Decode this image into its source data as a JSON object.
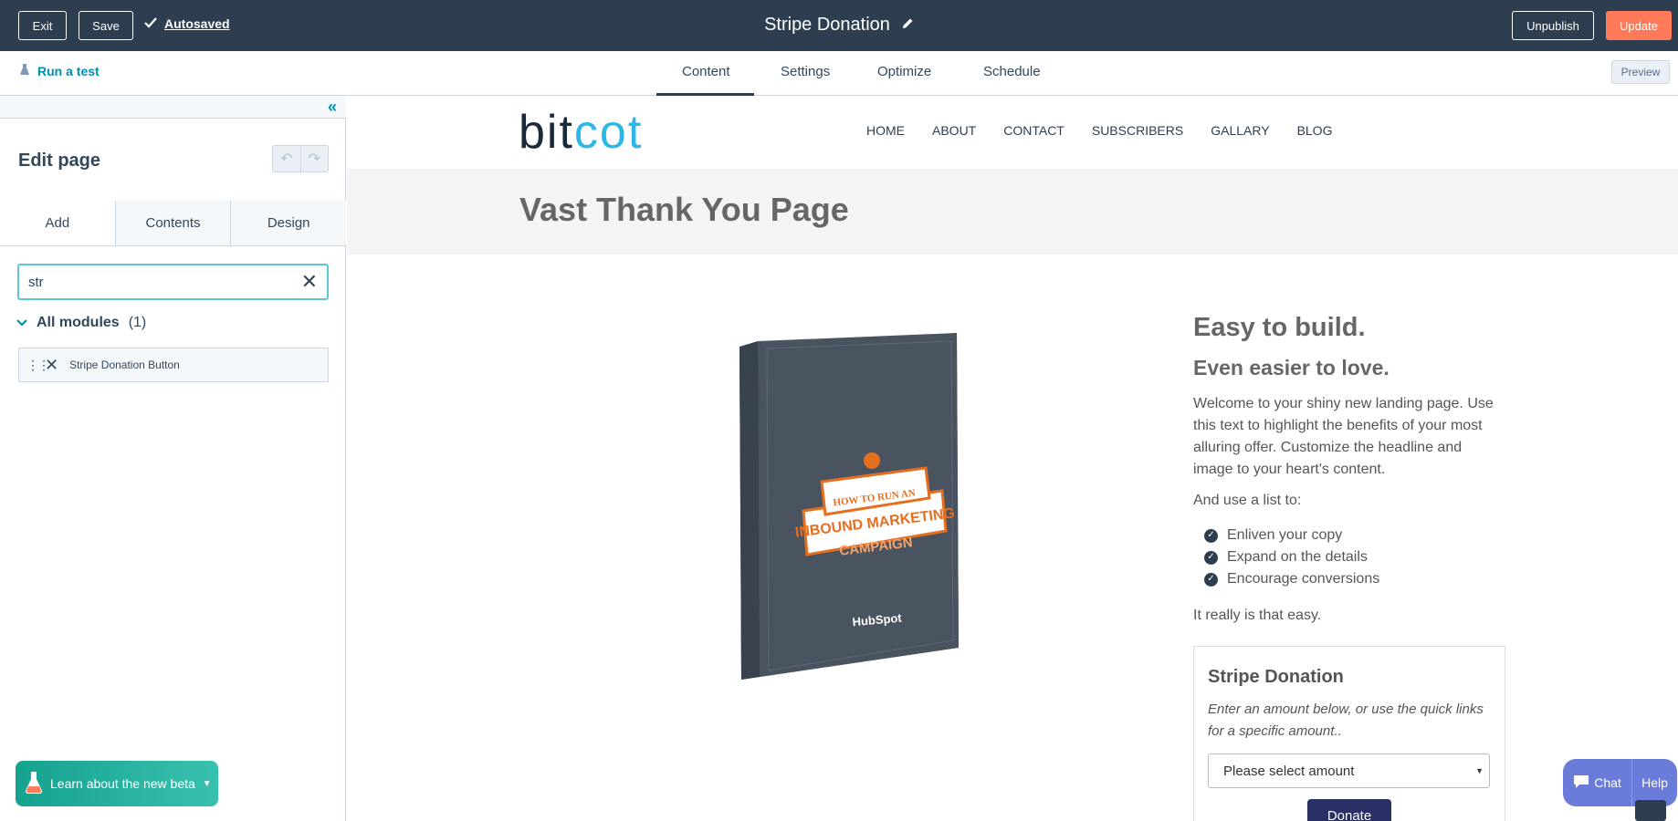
{
  "topbar": {
    "exit_label": "Exit",
    "save_label": "Save",
    "autosaved_label": "Autosaved",
    "page_title": "Stripe Donation",
    "unpublish_label": "Unpublish",
    "update_label": "Update"
  },
  "subbar": {
    "run_test_label": "Run a test",
    "tabs": [
      "Content",
      "Settings",
      "Optimize",
      "Schedule"
    ],
    "active_tab": "Content",
    "preview_label": "Preview"
  },
  "sidebar": {
    "edit_title": "Edit page",
    "tabs": [
      "Add",
      "Contents",
      "Design"
    ],
    "active_tab": "Add",
    "search_value": "str",
    "group_label": "All modules",
    "group_count": "(1)",
    "module_label": "Stripe Donation Button",
    "beta_label": "Learn about the new beta"
  },
  "page": {
    "logo_part1": "bit",
    "logo_part2": "cot",
    "nav": [
      "HOME",
      "ABOUT",
      "CONTACT",
      "SUBSCRIBERS",
      "GALLARY",
      "BLOG"
    ],
    "hero_title": "Vast Thank You Page",
    "book": {
      "line1": "HOW TO RUN AN",
      "line2": "INBOUND MARKETING",
      "line3": "CAMPAIGN",
      "brand": "HubSpot"
    },
    "heading1": "Easy to build.",
    "heading2": "Even easier to love.",
    "para1": "Welcome to your shiny new landing page. Use this text to highlight the benefits of your most alluring offer. Customize the headline and image to your heart's content.",
    "para2": "And use a list to:",
    "list": [
      "Enliven your copy",
      "Expand on the details",
      "Encourage conversions"
    ],
    "para3": "It really is that easy.",
    "stripe_title": "Stripe Donation",
    "stripe_desc": "Enter an amount below, or use the quick links for a specific amount..",
    "stripe_select": "Please select amount",
    "stripe_donate": "Donate"
  },
  "chat": {
    "chat_label": "Chat",
    "help_label": "Help"
  },
  "colors": {
    "topbar_bg": "#2d3e50",
    "accent": "#ff7a59",
    "link": "#0091ae",
    "logo_blue": "#2db7e8"
  }
}
